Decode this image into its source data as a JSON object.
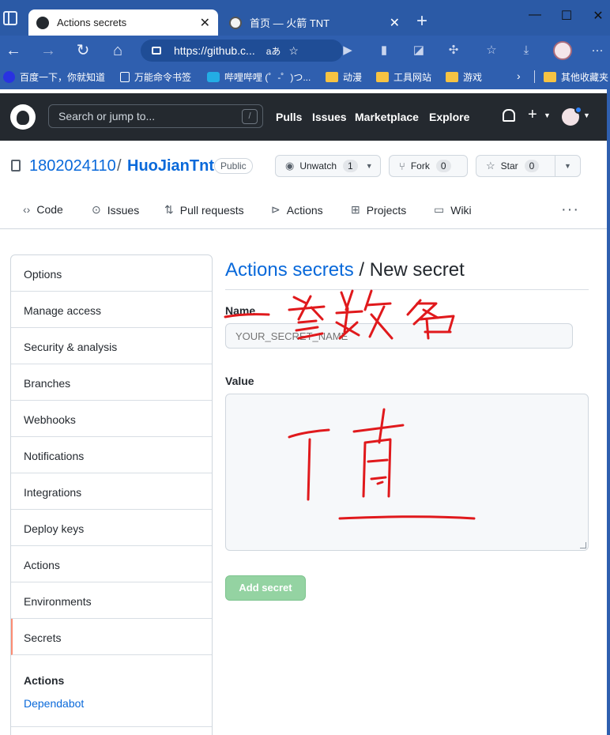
{
  "browser": {
    "tabs": [
      {
        "title": "Actions secrets",
        "active": true
      },
      {
        "title": "首页 — 火箭 TNT",
        "active": false
      }
    ],
    "url": "https://github.c...",
    "reader_label": "aあ",
    "bookmarks": [
      {
        "label": "百度一下，你就知道",
        "icon": "baidu-icon"
      },
      {
        "label": "万能命令书签",
        "icon": "page-icon"
      },
      {
        "label": "哔哩哔哩 (゜-゜)つ...",
        "icon": "bilibili-icon"
      },
      {
        "label": "动漫",
        "icon": "folder-icon"
      },
      {
        "label": "工具网站",
        "icon": "folder-icon"
      },
      {
        "label": "游戏",
        "icon": "folder-icon"
      },
      {
        "label": "其他收藏夹",
        "icon": "folder-icon"
      }
    ]
  },
  "github": {
    "search_placeholder": "Search or jump to...",
    "slash_key": "/",
    "nav": [
      "Pulls",
      "Issues",
      "Marketplace",
      "Explore"
    ]
  },
  "repo": {
    "owner": "1802024110",
    "separator": "/",
    "name": "HuoJianTnt",
    "visibility": "Public",
    "watch": {
      "label": "Unwatch",
      "count": "1"
    },
    "fork": {
      "label": "Fork",
      "count": "0"
    },
    "star": {
      "label": "Star",
      "count": "0"
    },
    "tabs": [
      "Code",
      "Issues",
      "Pull requests",
      "Actions",
      "Projects",
      "Wiki"
    ]
  },
  "sidebar": {
    "items": [
      "Options",
      "Manage access",
      "Security & analysis",
      "Branches",
      "Webhooks",
      "Notifications",
      "Integrations",
      "Deploy keys",
      "Actions",
      "Environments",
      "Secrets"
    ],
    "selected": "Secrets",
    "section_heading": "Actions",
    "section_link": "Dependabot"
  },
  "form": {
    "breadcrumb": "Actions secrets",
    "title_sep": " / ",
    "title": "New secret",
    "name_label": "Name",
    "name_placeholder": "YOUR_SECRET_NAME",
    "value_label": "Value",
    "submit_label": "Add secret"
  },
  "colors": {
    "accent": "#0969da",
    "header_bg": "#24292f",
    "browser_bg": "#2f5faf",
    "selected_marker": "#fd8c73",
    "submit_disabled": "#94d3a2",
    "ink": "#e0191c"
  }
}
